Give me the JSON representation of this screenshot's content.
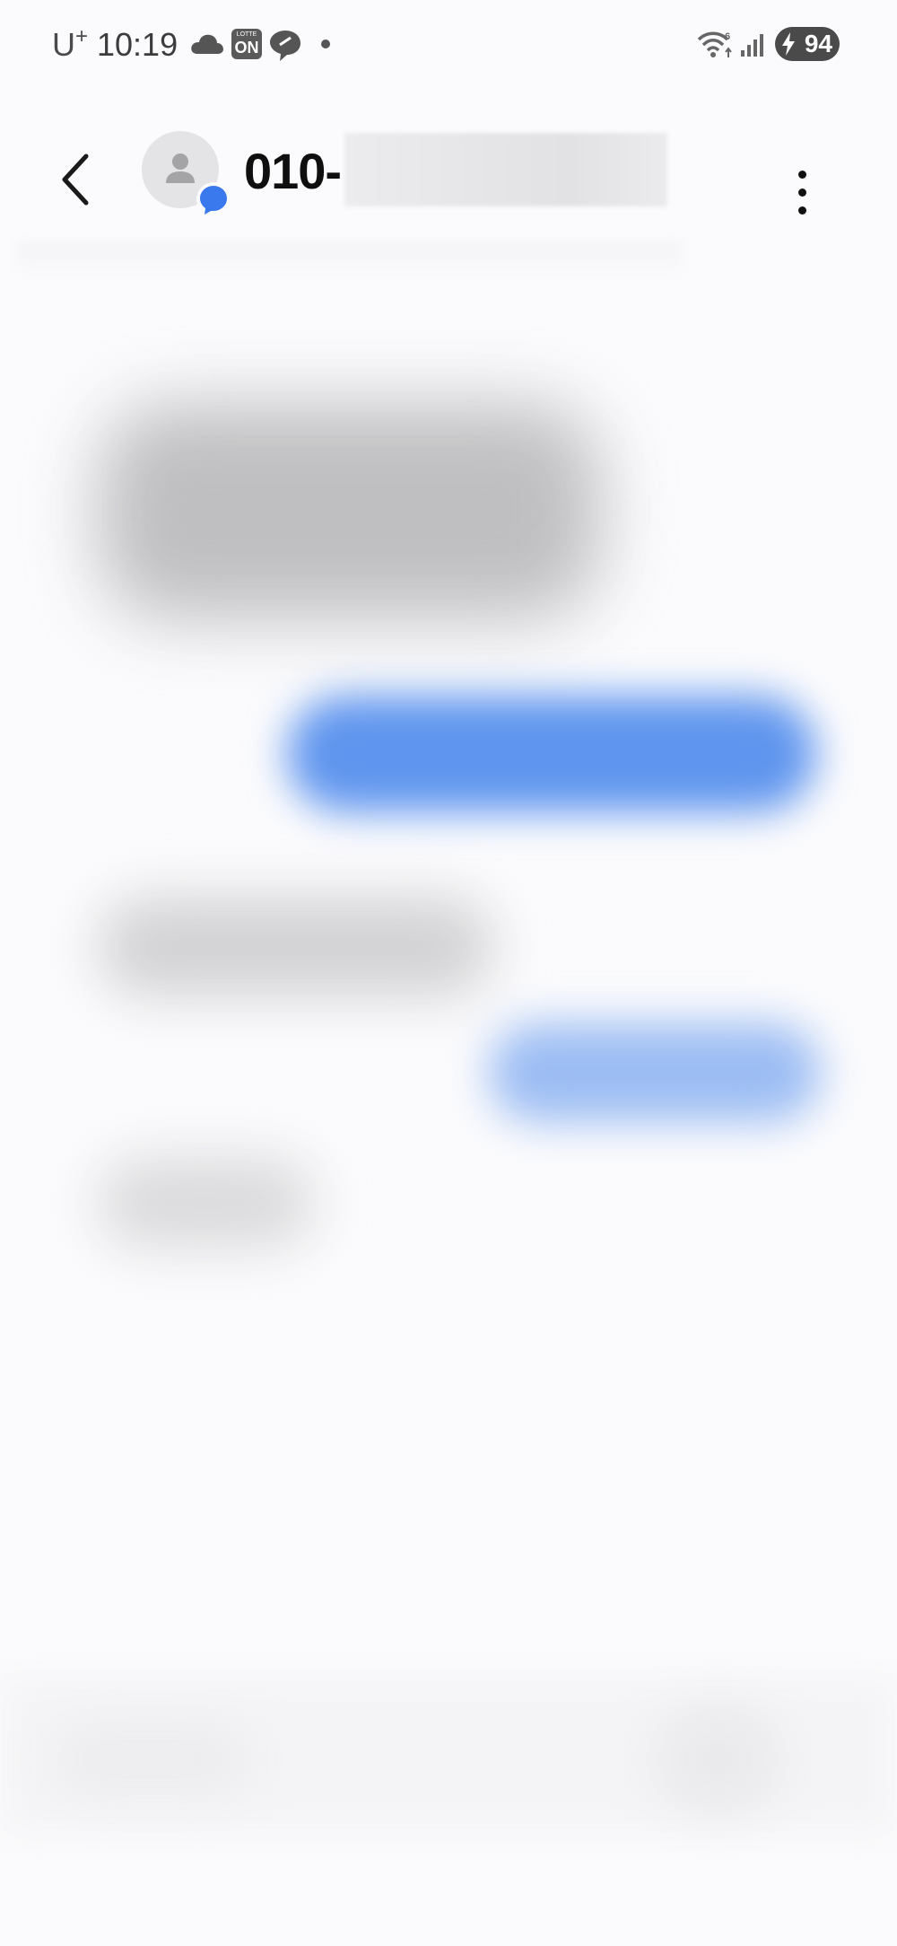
{
  "status_bar": {
    "carrier": "U",
    "carrier_plus": "+",
    "time": "10:19",
    "icons": [
      "cloud-icon",
      "lotte-on-icon",
      "chat-bubble-icon",
      "notification-dot-icon",
      "wifi-6-icon",
      "signal-icon",
      "battery-charging-icon"
    ],
    "lotte_on_small": "LOTTE",
    "lotte_on_big": "ON",
    "battery_level": "94"
  },
  "app_bar": {
    "title": "010-",
    "icons": [
      "back-arrow-icon",
      "person-icon",
      "chat-bubble-badge-icon",
      "more-vertical-icon"
    ]
  },
  "colors": {
    "background": "#fbfbfd",
    "outgoing_bubble": "#5f95ee",
    "incoming_bubble": "#cfcfd1",
    "badge_blue": "#3a78ee",
    "title_text": "#0f0f0f"
  }
}
